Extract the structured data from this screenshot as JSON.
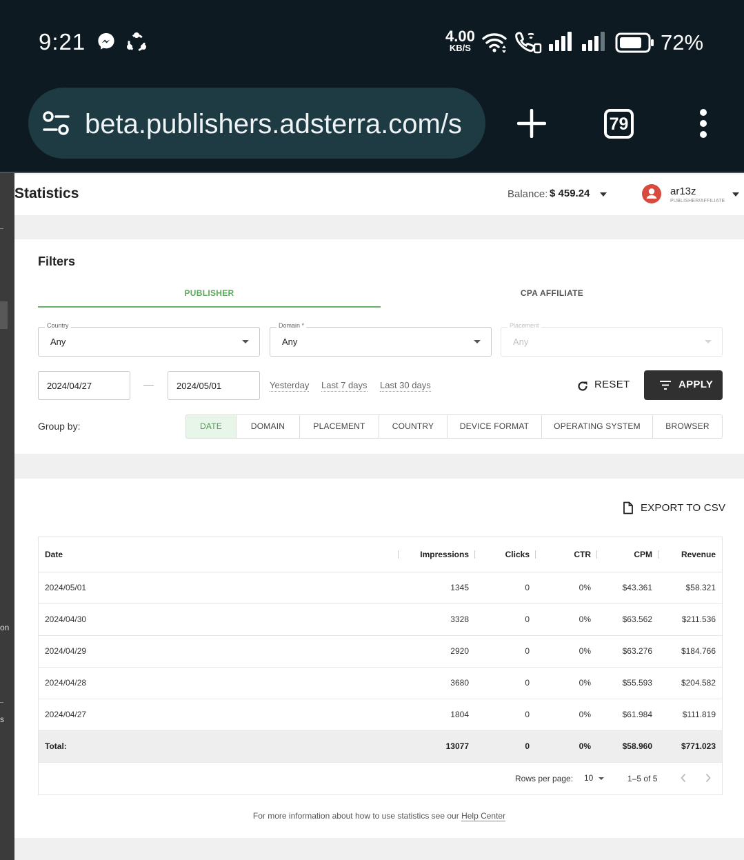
{
  "status_bar": {
    "time": "9:21",
    "speed_value": "4.00",
    "speed_unit": "KB/S",
    "battery_percent": "72%",
    "icons": [
      "messenger-icon",
      "share-app-icon",
      "wifi-icon",
      "wifi-calling-icon",
      "signal-icon",
      "signal-icon",
      "battery-icon"
    ]
  },
  "browser": {
    "url": "beta.publishers.adsterra.com/s",
    "tab_count": "79",
    "icons": [
      "site-settings-icon",
      "new-tab-icon",
      "menu-dots-icon"
    ]
  },
  "header": {
    "title": "Statistics",
    "balance_label": "Balance:",
    "balance_value": "$ 459.24",
    "user_name": "ar13z",
    "user_role": "PUBLISHER/AFFILIATE"
  },
  "sidebar": {
    "visible_fragments": [
      "on",
      "s"
    ]
  },
  "filters": {
    "title": "Filters",
    "tabs": [
      {
        "label": "PUBLISHER",
        "active": true
      },
      {
        "label": "CPA AFFILIATE",
        "active": false
      }
    ],
    "country": {
      "label": "Country",
      "value": "Any"
    },
    "domain": {
      "label": "Domain *",
      "value": "Any"
    },
    "placement": {
      "label": "Placement",
      "value": "Any",
      "disabled": true
    },
    "date_from": "2024/04/27",
    "date_to": "2024/05/01",
    "quick_ranges": [
      "Yesterday",
      "Last 7 days",
      "Last 30 days"
    ],
    "reset_label": "RESET",
    "apply_label": "APPLY",
    "group_by_label": "Group by:",
    "group_by_options": [
      "DATE",
      "DOMAIN",
      "PLACEMENT",
      "COUNTRY",
      "DEVICE FORMAT",
      "OPERATING SYSTEM",
      "BROWSER"
    ],
    "group_by_selected": "DATE"
  },
  "stats": {
    "export_label": "EXPORT TO CSV",
    "columns": [
      "Date",
      "Impressions",
      "Clicks",
      "CTR",
      "CPM",
      "Revenue"
    ],
    "rows": [
      [
        "2024/05/01",
        "1345",
        "0",
        "0%",
        "$43.361",
        "$58.321"
      ],
      [
        "2024/04/30",
        "3328",
        "0",
        "0%",
        "$63.562",
        "$211.536"
      ],
      [
        "2024/04/29",
        "2920",
        "0",
        "0%",
        "$63.276",
        "$184.766"
      ],
      [
        "2024/04/28",
        "3680",
        "0",
        "0%",
        "$55.593",
        "$204.582"
      ],
      [
        "2024/04/27",
        "1804",
        "0",
        "0%",
        "$61.984",
        "$111.819"
      ]
    ],
    "total": [
      "Total:",
      "13077",
      "0",
      "0%",
      "$58.960",
      "$771.023"
    ],
    "rows_per_page_label": "Rows per page:",
    "rows_per_page_value": "10",
    "range_text": "1–5 of 5"
  },
  "help": {
    "text": "For more information about how to use statistics see our",
    "link": "Help Center"
  },
  "colors": {
    "chrome_bg": "#0d1a21",
    "url_bar_bg": "#1e3a43",
    "accent_green": "#5aa95a",
    "apply_bg": "#303030",
    "avatar_red": "#d84a3d"
  }
}
